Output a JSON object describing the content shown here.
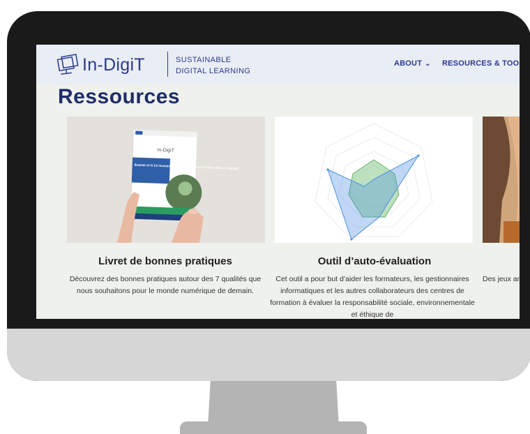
{
  "brand": {
    "name": "In-DigiT",
    "tagline_line1": "SUSTAINABLE",
    "tagline_line2": "DIGITAL LEARNING"
  },
  "nav": {
    "about": "ABOUT",
    "resources": "RESOURCES & TOO"
  },
  "page_title": "Ressources",
  "cards": [
    {
      "title": "Livret de bonnes pratiques",
      "description": "Découvrez des bonnes pratiques autour des 7 qualités que nous souhaitons pour le monde numérique de demain.",
      "booklet": {
        "brand": "In-DigiT",
        "title": "Booklet of IX EU Sustainable IT Best Practices for Education & Training"
      }
    },
    {
      "title": "Outil d’auto-évaluation",
      "description": "Cet outil a pour but d’aider les formateurs, les gestionnaires informatiques et les autres collaborateurs des centres de formation à évaluer la responsabilité sociale, environnementale et éthique de"
    },
    {
      "title": "",
      "description": "Des jeux améliorer le"
    }
  ],
  "colors": {
    "brand_navy": "#2b3a8c",
    "title_navy": "#1e2c68",
    "radar_blue": "#4a90e2",
    "radar_green": "#7bc47f"
  }
}
